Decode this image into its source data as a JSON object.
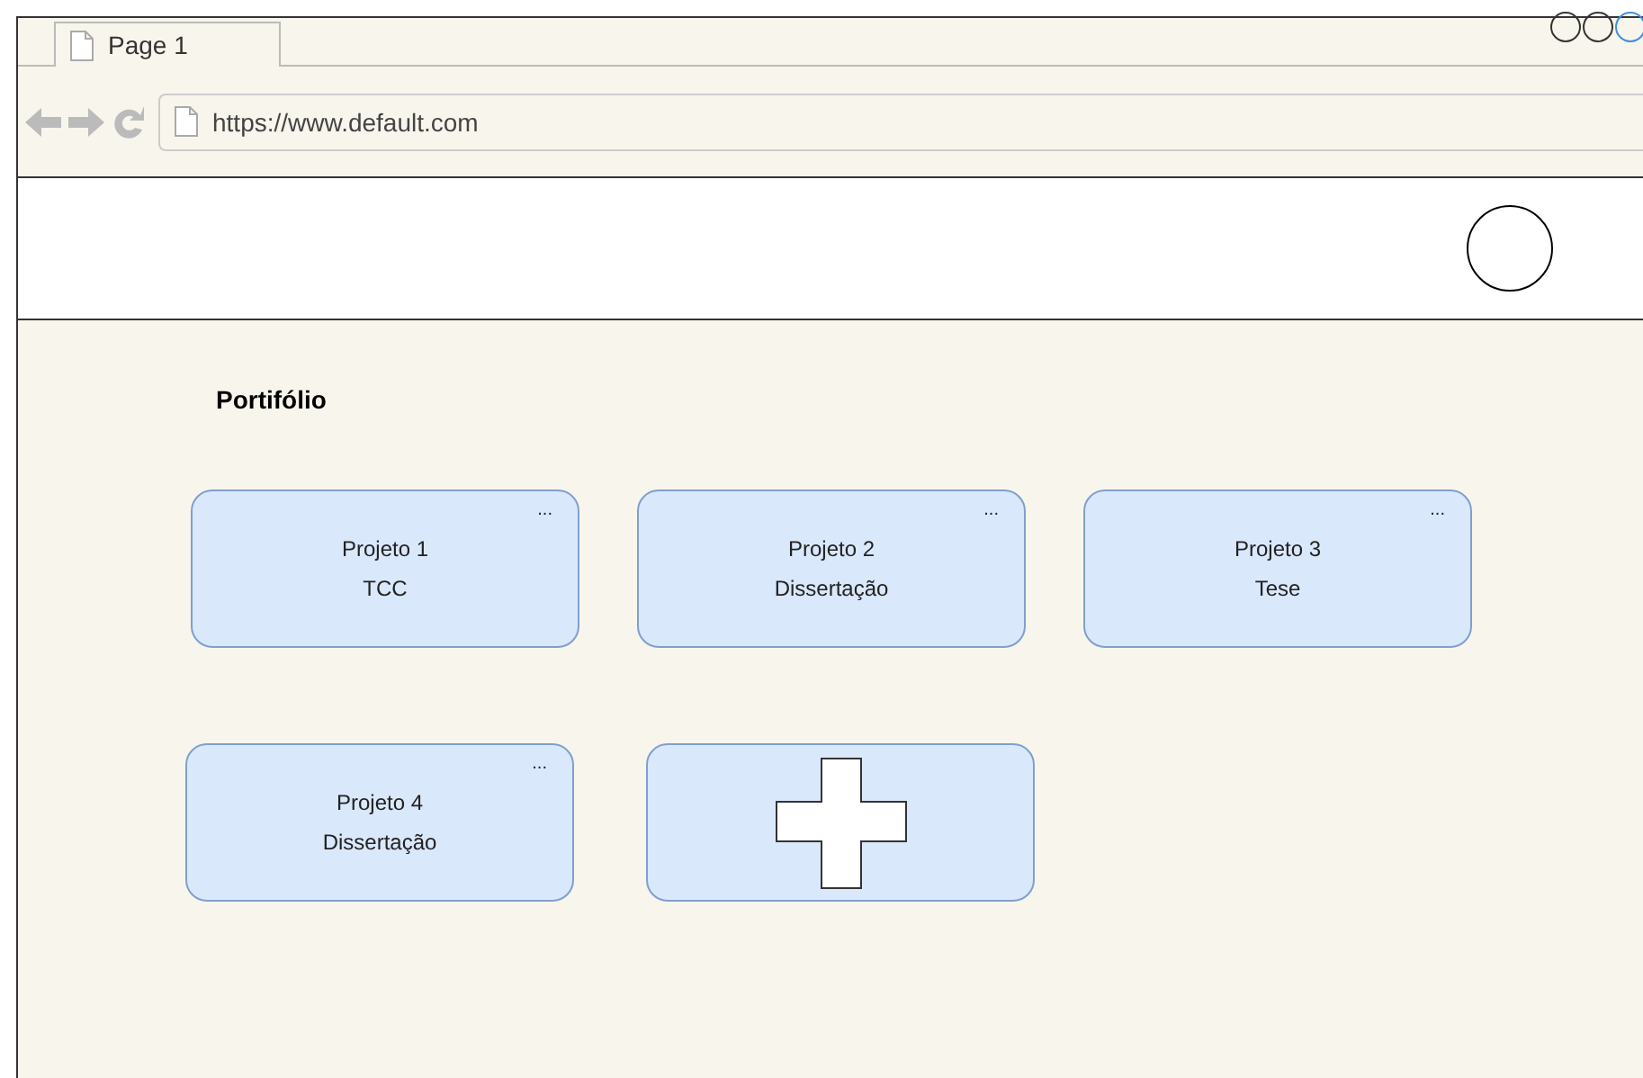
{
  "browser": {
    "tab": {
      "label": "Page 1"
    },
    "url": "https://www.default.com"
  },
  "page": {
    "title": "Portifólio",
    "rows": [
      {
        "projects": [
          {
            "kind": "project",
            "name": "Projeto 1",
            "type": "TCC",
            "menu": "..."
          },
          {
            "kind": "project",
            "name": "Projeto 2",
            "type": "Dissertação",
            "menu": "..."
          },
          {
            "kind": "project",
            "name": "Projeto 3",
            "type": "Tese",
            "menu": "..."
          }
        ]
      },
      {
        "projects": [
          {
            "kind": "project",
            "name": "Projeto 4",
            "type": "Dissertação",
            "menu": "..."
          },
          {
            "kind": "add"
          }
        ]
      }
    ]
  }
}
